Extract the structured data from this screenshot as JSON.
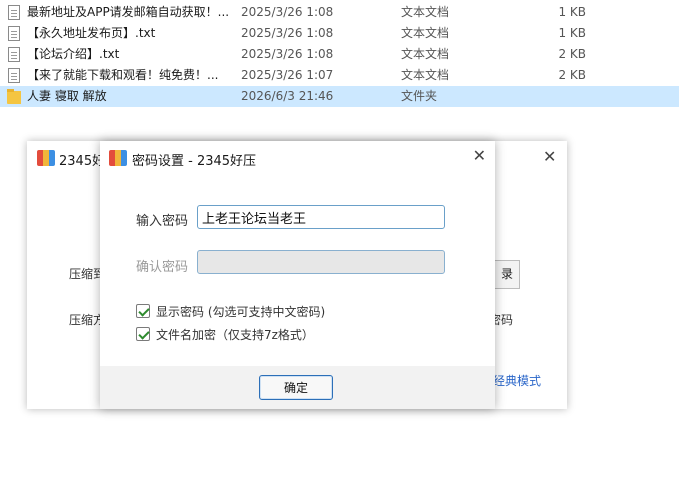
{
  "files": [
    {
      "name": "最新地址及APP请发邮箱自动获取！...",
      "date": "2025/3/26 1:08",
      "type": "文本文档",
      "size": "1 KB",
      "icon": "text-file-icon"
    },
    {
      "name": "【永久地址发布页】.txt",
      "date": "2025/3/26 1:08",
      "type": "文本文档",
      "size": "1 KB",
      "icon": "text-file-icon"
    },
    {
      "name": "【论坛介绍】.txt",
      "date": "2025/3/26 1:08",
      "type": "文本文档",
      "size": "2 KB",
      "icon": "text-file-icon"
    },
    {
      "name": "【来了就能下载和观看！纯免费！...",
      "date": "2025/3/26 1:07",
      "type": "文本文档",
      "size": "2 KB",
      "icon": "text-file-icon"
    },
    {
      "name": "人妻 寝取 解放",
      "date": "2026/6/3 21:46",
      "type": "文件夹",
      "size": "",
      "icon": "folder-icon"
    }
  ],
  "back_window": {
    "title": "2345好",
    "label_compress_to": "压缩到",
    "label_compress_method": "压缩方",
    "browse_button_fragment": "录",
    "side_text_fragment": "密码",
    "classic_mode_link": "经典模式"
  },
  "dialog": {
    "title": "密码设置 - 2345好压",
    "password_label": "输入密码",
    "password_value": "上老王论坛当老王",
    "confirm_label": "确认密码",
    "confirm_value": "",
    "show_password_label": "显示密码 (勾选可支持中文密码)",
    "show_password_checked": true,
    "encrypt_filenames_label": "文件名加密（仅支持7z格式）",
    "encrypt_filenames_checked": true,
    "ok_label": "确定"
  },
  "colors": {
    "selection": "#cce8ff",
    "accent": "#2c6fb8",
    "link": "#2a66c9"
  }
}
